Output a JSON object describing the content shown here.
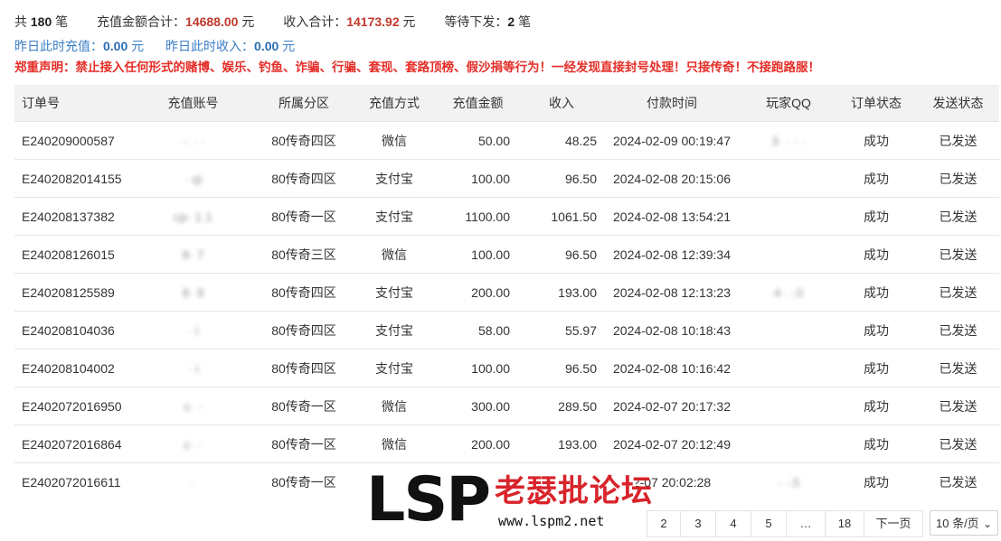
{
  "summary": {
    "total_prefix": "共",
    "total_count": "180",
    "total_suffix": "笔",
    "recharge_label": "充值金额合计：",
    "recharge_total": "14688.00",
    "recharge_unit": "元",
    "income_label": "收入合计：",
    "income_total": "14173.92",
    "income_unit": "元",
    "pending_label": "等待下发：",
    "pending_count": "2",
    "pending_unit": "笔"
  },
  "yesterday": {
    "recharge_label": "昨日此时充值：",
    "recharge_value": "0.00",
    "recharge_unit": "元",
    "income_label": "昨日此时收入：",
    "income_value": "0.00",
    "income_unit": "元"
  },
  "notice": "郑重声明：禁止接入任何形式的赌博、娱乐、钓鱼、诈骗、行骗、套现、套路顶榜、假沙捐等行为！一经发现直接封号处理！只接传奇！不接跑路服！",
  "table": {
    "headers": [
      "订单号",
      "充值账号",
      "所属分区",
      "充值方式",
      "充值金额",
      "收入",
      "付款时间",
      "玩家QQ",
      "订单状态",
      "发送状态"
    ],
    "rows": [
      {
        "order": "E2402090005​87",
        "account": "·· · ·",
        "zone": "80传奇四区",
        "method": "微信",
        "amount": "50.00",
        "income": "48.25",
        "time": "2024-02-09 00:19:47",
        "qq": "3· · · ·",
        "status": "成功",
        "send": "已发送"
      },
      {
        "order": "E2402082014155",
        "account": "· qi",
        "zone": "80传奇四区",
        "method": "支付宝",
        "amount": "100.00",
        "income": "96.50",
        "time": "2024-02-08 20:15:06",
        "qq": "",
        "status": "成功",
        "send": "已发送"
      },
      {
        "order": "E240208137382",
        "account": "cp· 1.1",
        "zone": "80传奇一区",
        "method": "支付宝",
        "amount": "1100.00",
        "income": "1061.50",
        "time": "2024-02-08 13:54:21",
        "qq": "",
        "status": "成功",
        "send": "已发送"
      },
      {
        "order": "E240208126015",
        "account": "8· 7",
        "zone": "80传奇三区",
        "method": "微信",
        "amount": "100.00",
        "income": "96.50",
        "time": "2024-02-08 12:39:34",
        "qq": "",
        "status": "成功",
        "send": "已发送"
      },
      {
        "order": "E240208125589",
        "account": "8· 9",
        "zone": "80传奇四区",
        "method": "支付宝",
        "amount": "200.00",
        "income": "193.00",
        "time": "2024-02-08 12:13:23",
        "qq": "4· ·.0",
        "status": "成功",
        "send": "已发送"
      },
      {
        "order": "E240208104036",
        "account": "· i",
        "zone": "80传奇四区",
        "method": "支付宝",
        "amount": "58.00",
        "income": "55.97",
        "time": "2024-02-08 10:18:43",
        "qq": "",
        "status": "成功",
        "send": "已发送"
      },
      {
        "order": "E240208104002",
        "account": "· i",
        "zone": "80传奇四区",
        "method": "支付宝",
        "amount": "100.00",
        "income": "96.50",
        "time": "2024-02-08 10:16:42",
        "qq": "",
        "status": "成功",
        "send": "已发送"
      },
      {
        "order": "E2402072016950",
        "account": "c· ·",
        "zone": "80传奇一区",
        "method": "微信",
        "amount": "300.00",
        "income": "289.50",
        "time": "2024-02-07 20:17:32",
        "qq": "",
        "status": "成功",
        "send": "已发送"
      },
      {
        "order": "E2402072016864",
        "account": "c· ·",
        "zone": "80传奇一区",
        "method": "微信",
        "amount": "200.00",
        "income": "193.00",
        "time": "2024-02-07 20:12:49",
        "qq": "",
        "status": "成功",
        "send": "已发送"
      },
      {
        "order": "E2402072016611",
        "account": "·",
        "zone": "80传奇一区",
        "method": "",
        "amount": "",
        "income": "",
        "time": "2-07 20:02:28",
        "qq": "· ·.5",
        "status": "成功",
        "send": "已发送"
      }
    ]
  },
  "pagination": {
    "pages": [
      "2",
      "3",
      "4",
      "5",
      "…",
      "18"
    ],
    "next_label": "下一页",
    "page_size": "10 条/页"
  },
  "watermark": {
    "logo": "LSP",
    "name": "老瑟批论坛",
    "url": "www.lspm2.net"
  },
  "colors": {
    "accent_red": "#c0392b",
    "link_blue": "#3a7ec6",
    "success_green": "#2f7f6f",
    "header_bg": "#f2f2f2"
  }
}
